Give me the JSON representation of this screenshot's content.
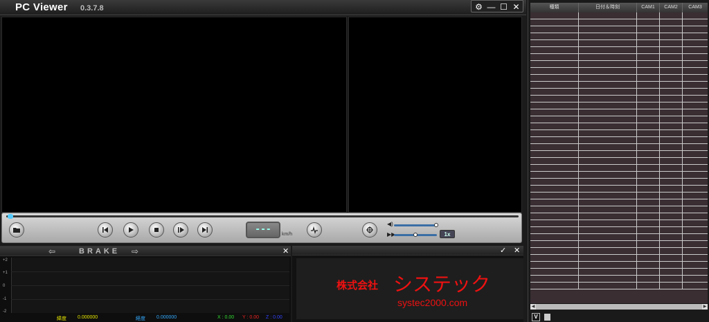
{
  "window": {
    "title": "PC Viewer",
    "version": "0.3.7.8",
    "controls": [
      "gear-icon",
      "minimize-icon",
      "maximize-icon",
      "close-icon"
    ]
  },
  "player": {
    "speed_display": "---",
    "speed_unit": "km/h",
    "rate": "1x",
    "seek_position": 0,
    "buttons": [
      "open-folder-icon",
      "skip-back-icon",
      "play-icon",
      "stop-icon",
      "step-forward-icon",
      "skip-forward-icon",
      "waveform-icon",
      "crosshair-icon"
    ]
  },
  "graph": {
    "title": "BRAKE",
    "y_ticks": [
      "+2",
      "+1",
      "0",
      "-1",
      "-2"
    ],
    "latitude_label": "緯度",
    "latitude_value": "0.000000",
    "longitude_label": "経度",
    "longitude_value": "0.000000",
    "x_label": "X : 0.00",
    "y_label": "Y : 0.00",
    "z_label": "Z : 0.00"
  },
  "logo": {
    "company": "株式会社",
    "brand": "システック",
    "website": "systec2000.com"
  },
  "list": {
    "columns": [
      "種類",
      "日付＆時刻",
      "CAM1",
      "CAM2",
      "CAM3"
    ],
    "row_count": 40,
    "footer_button": "V"
  },
  "colors": {
    "brand_red": "#e11111",
    "latitude": "#e5e500",
    "longitude": "#33aaff",
    "x_axis": "#33dd33",
    "y_axis": "#ee2222",
    "z_axis": "#3344ff"
  }
}
